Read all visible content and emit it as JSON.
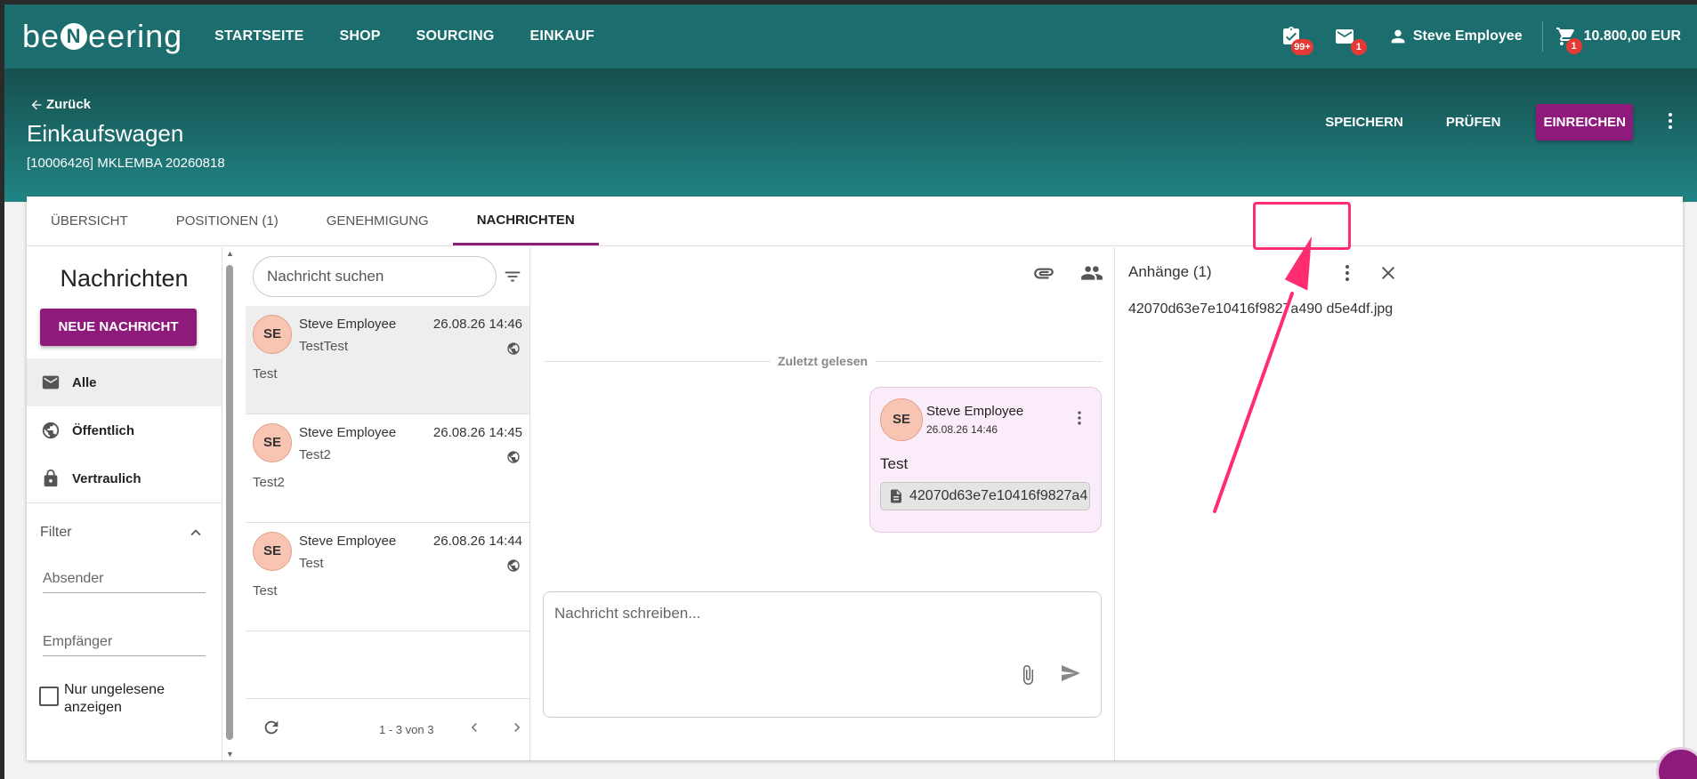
{
  "brand": {
    "logo_left": "be",
    "logo_badge": "N",
    "logo_right": "eering"
  },
  "nav": [
    "STARTSEITE",
    "SHOP",
    "SOURCING",
    "EINKAUF"
  ],
  "topbar": {
    "tasks_badge": "99+",
    "mail_badge": "1",
    "user_name": "Steve Employee",
    "cart_badge": "1",
    "cart_total": "10.800,00 EUR"
  },
  "header": {
    "back_label": "Zurück",
    "title": "Einkaufswagen",
    "subtitle": "[10006426] MKLEMBA 20260818",
    "save": "SPEICHERN",
    "check": "PRÜFEN",
    "submit": "EINREICHEN"
  },
  "tabs": [
    "ÜBERSICHT",
    "POSITIONEN (1)",
    "GENEHMIGUNG",
    "NACHRICHTEN"
  ],
  "active_tab": "NACHRICHTEN",
  "left": {
    "title": "Nachrichten",
    "new_button": "NEUE NACHRICHT",
    "folders": [
      "Alle",
      "Öffentlich",
      "Vertraulich"
    ],
    "filter_label": "Filter",
    "sender_field": "Absender",
    "recipient_field": "Empfänger",
    "unread_label": "Nur ungelesene anzeigen"
  },
  "list": {
    "search_placeholder": "Nachricht suchen",
    "messages": [
      {
        "initials": "SE",
        "sender": "Steve Employee",
        "date": "26.08.26 14:46",
        "subject": "TestTest",
        "preview": "Test"
      },
      {
        "initials": "SE",
        "sender": "Steve Employee",
        "date": "26.08.26 14:45",
        "subject": "Test2",
        "preview": "Test2"
      },
      {
        "initials": "SE",
        "sender": "Steve Employee",
        "date": "26.08.26 14:44",
        "subject": "Test",
        "preview": "Test"
      }
    ],
    "paging": "1 - 3 von 3"
  },
  "conversation": {
    "last_read": "Zuletzt gelesen",
    "bubble": {
      "initials": "SE",
      "sender": "Steve Employee",
      "date": "26.08.26 14:46",
      "text": "Test",
      "attachment": "42070d63e7e10416f9827a4…"
    },
    "compose_placeholder": "Nachricht schreiben..."
  },
  "attachments": {
    "title": "Anhänge (1)",
    "file": "42070d63e7e10416f9827a490 d5e4df.jpg"
  },
  "colors": {
    "primary": "#8e1a7c",
    "header": "#1c6e6e",
    "annotation": "#ff2d6f"
  }
}
